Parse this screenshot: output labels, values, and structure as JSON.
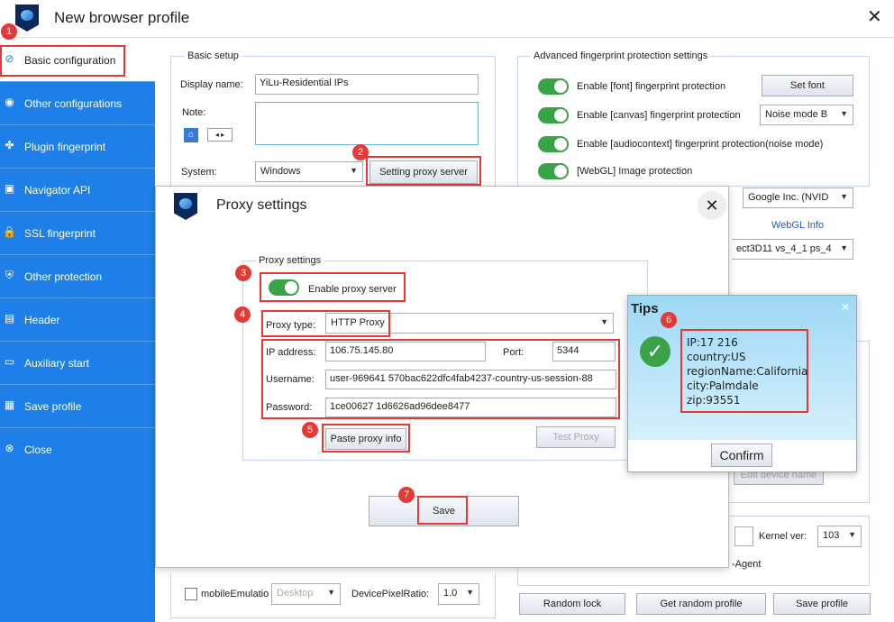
{
  "window": {
    "title": "New browser profile",
    "close_glyph": "✕"
  },
  "sidebar": {
    "items": [
      {
        "label": "Basic configuration",
        "icon": "compass-icon",
        "glyph": "⊘"
      },
      {
        "label": "Other configurations",
        "icon": "chrome-icon",
        "glyph": "◉"
      },
      {
        "label": "Plugin fingerprint",
        "icon": "plugin-icon",
        "glyph": "✤"
      },
      {
        "label": "Navigator API",
        "icon": "api-icon",
        "glyph": "▣"
      },
      {
        "label": "SSL fingerprint",
        "icon": "lock-icon",
        "glyph": "🔒"
      },
      {
        "label": "Other protection",
        "icon": "shield-icon",
        "glyph": "⛨"
      },
      {
        "label": "Header",
        "icon": "header-icon",
        "glyph": "▤"
      },
      {
        "label": "Auxiliary start",
        "icon": "cmd-icon",
        "glyph": "▭"
      },
      {
        "label": "Save profile",
        "icon": "save-icon",
        "glyph": "▦"
      },
      {
        "label": "Close",
        "icon": "close-icon",
        "glyph": "⊗"
      }
    ]
  },
  "badges": [
    "1",
    "2",
    "3",
    "4",
    "5",
    "6",
    "7"
  ],
  "basic": {
    "group": "Basic setup",
    "display_name_label": "Display name:",
    "display_name": "YiLu-Residential IPs",
    "note_label": "Note:",
    "system_label": "System:",
    "system": "Windows",
    "proxy_button": "Setting proxy server"
  },
  "advanced": {
    "group": "Advanced fingerprint protection settings",
    "font": "Enable [font] fingerprint protection",
    "font_button": "Set font",
    "canvas": "Enable [canvas] fingerprint protection",
    "canvas_mode": "Noise mode B",
    "audio": "Enable [audiocontext] fingerprint  protection(noise mode)",
    "webgl": "[WebGL] Image protection",
    "webgl_vendor": "Google Inc. (NVID",
    "webgl_info": "WebGL Info",
    "webgl_renderer": "ect3D11 vs_4_1 ps_4"
  },
  "bottom": {
    "mobile_label": "mobileEmulatio",
    "mobile_select": "Desktop",
    "dpr_label": "DevicePixelRatio:",
    "dpr": "1.0",
    "kernel_label": "Kernel ver:",
    "kernel": "103",
    "ua_label": "-Agent",
    "random_lock": "Random lock",
    "get_random": "Get random profile",
    "save_profile": "Save profile",
    "edit_device": "Edit device name"
  },
  "proxy": {
    "title": "Proxy settings",
    "close_glyph": "✕",
    "group": "Proxy settings",
    "enable_label": "Enable proxy server",
    "type_label": "Proxy type:",
    "type": "HTTP Proxy",
    "ip_label": "IP address:",
    "ip": "106.75.145.80",
    "port_label": "Port:",
    "port": "5344",
    "user_label": "Username:",
    "user": "user-969641     570bac622dfc4fab4237-country-us-session-88",
    "pass_label": "Password:",
    "pass": "1ce00627        1d6626ad96dee8477",
    "paste": "Paste proxy info",
    "test": "Test Proxy",
    "save": "Save"
  },
  "tips": {
    "title": "Tips",
    "close_glyph": "✕",
    "ip": "IP:17          216",
    "country": "country:US",
    "region": "regionName:California",
    "city": "city:Palmdale",
    "zip": "zip:93551",
    "confirm": "Confirm"
  }
}
